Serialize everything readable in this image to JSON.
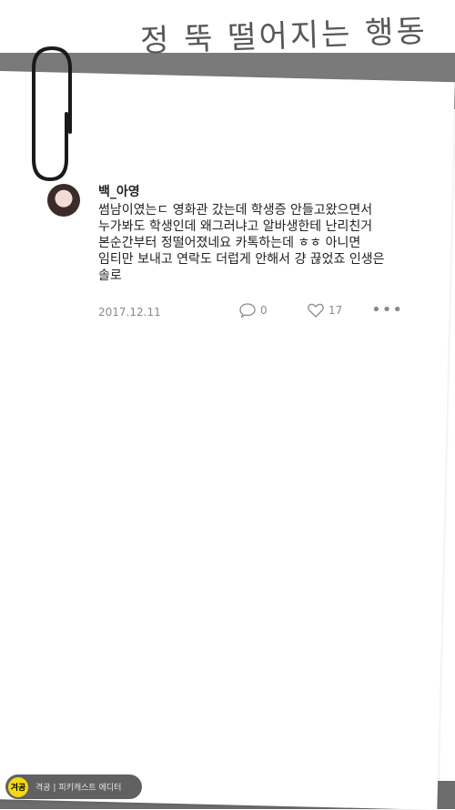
{
  "header": {
    "title": "정 뚝 떨어지는 행동"
  },
  "post": {
    "username": "백_아영",
    "text": "썸남이였는ㄷ 영화관 갔는데 학생증 안들고왔으면서\n누가봐도 학생인데 왜그러냐고 알바생한테 난리친거\n본순간부터 정떨어졌네요 카톡하는데 ㅎㅎ 아니면\n임티만 보내고 연락도 더럽게 안해서 걍 끊었죠 인생은\n솔로",
    "date": "2017.12.11",
    "comment_count": "0",
    "like_count": "17",
    "more_label": "•••"
  },
  "footer": {
    "logo": "겨공",
    "editor": "격공 | 피키캐스트 에디터"
  }
}
